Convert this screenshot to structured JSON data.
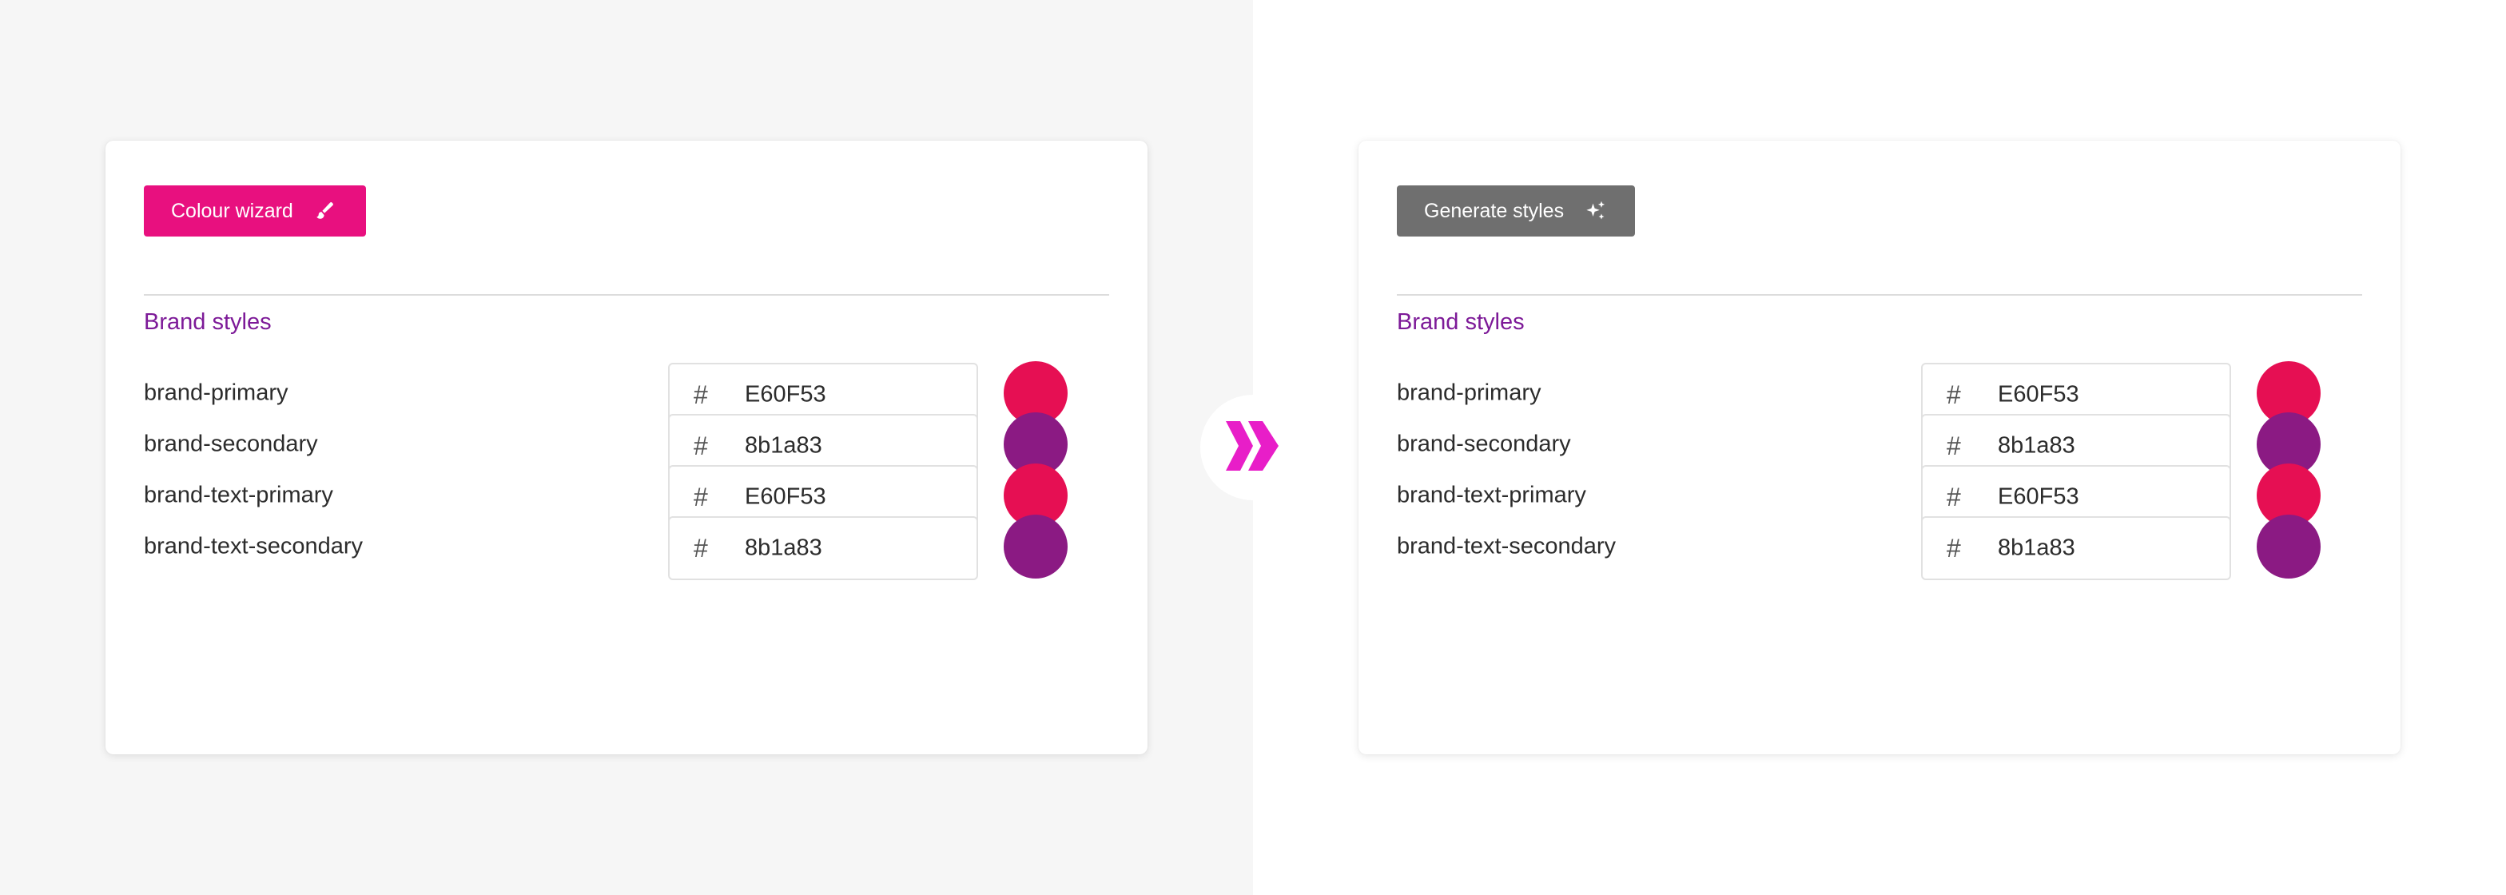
{
  "colors": {
    "left_bg": "#f6f6f6",
    "right_bg": "#ffffff",
    "wizard_button": "#e8107f",
    "generate_button": "#6f6f6f",
    "section_title": "#7d1a98",
    "arrow": "#e81ec8"
  },
  "icons": {
    "wizard": "paintbrush-icon",
    "generate": "sparkles-icon",
    "separator": "double-chevron-right-icon"
  },
  "before": {
    "button_label": "Colour wizard",
    "section_title": "Brand styles",
    "rows": [
      {
        "label": "brand-primary",
        "prefix": "#",
        "value": "E60F53",
        "swatch": "#e60f53"
      },
      {
        "label": "brand-secondary",
        "prefix": "#",
        "value": "8b1a83",
        "swatch": "#8b1a83"
      },
      {
        "label": "brand-text-primary",
        "prefix": "#",
        "value": "E60F53",
        "swatch": "#e60f53"
      },
      {
        "label": "brand-text-secondary",
        "prefix": "#",
        "value": "8b1a83",
        "swatch": "#8b1a83"
      }
    ]
  },
  "after": {
    "button_label": "Generate styles",
    "section_title": "Brand styles",
    "rows": [
      {
        "label": "brand-primary",
        "prefix": "#",
        "value": "E60F53",
        "swatch": "#e60f53"
      },
      {
        "label": "brand-secondary",
        "prefix": "#",
        "value": "8b1a83",
        "swatch": "#8b1a83"
      },
      {
        "label": "brand-text-primary",
        "prefix": "#",
        "value": "E60F53",
        "swatch": "#e60f53"
      },
      {
        "label": "brand-text-secondary",
        "prefix": "#",
        "value": "8b1a83",
        "swatch": "#8b1a83"
      }
    ]
  }
}
